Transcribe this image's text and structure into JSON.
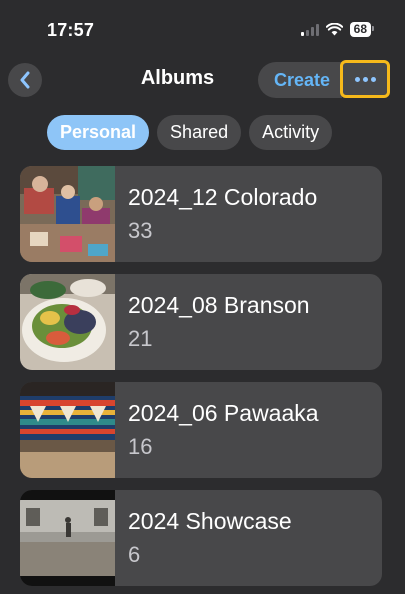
{
  "status": {
    "time": "17:57",
    "battery": "68"
  },
  "nav": {
    "title": "Albums",
    "create_label": "Create"
  },
  "tabs": [
    {
      "label": "Personal",
      "active": true
    },
    {
      "label": "Shared",
      "active": false
    },
    {
      "label": "Activity",
      "active": false
    }
  ],
  "albums": [
    {
      "name": "2024_12 Colorado",
      "count": "33"
    },
    {
      "name": "2024_08 Branson",
      "count": "21"
    },
    {
      "name": "2024_06 Pawaaka",
      "count": "16"
    },
    {
      "name": "2024 Showcase",
      "count": "6"
    }
  ],
  "colors": {
    "accent": "#64b5f6",
    "highlight": "#f6b91b",
    "background": "#2c2c2e",
    "row": "#48484a"
  }
}
